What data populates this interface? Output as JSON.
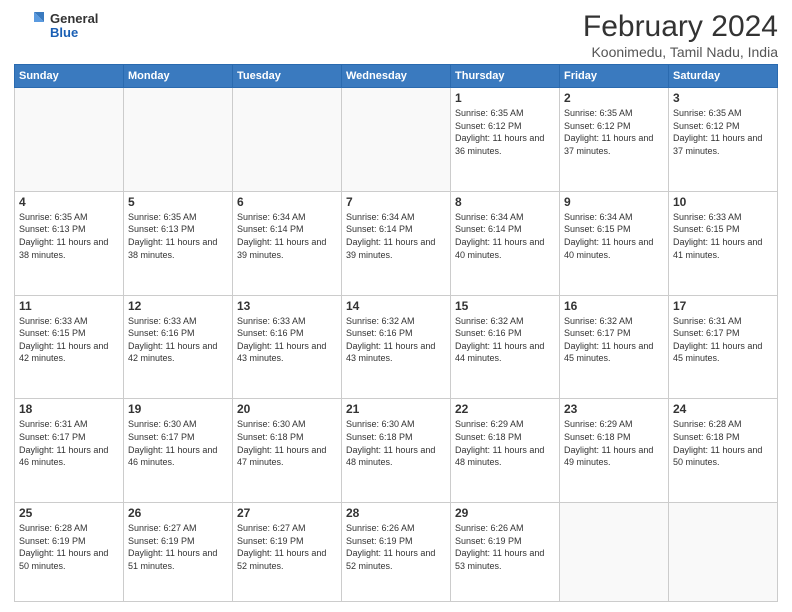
{
  "header": {
    "logo_general": "General",
    "logo_blue": "Blue",
    "title": "February 2024",
    "subtitle": "Koonimedu, Tamil Nadu, India"
  },
  "weekdays": [
    "Sunday",
    "Monday",
    "Tuesday",
    "Wednesday",
    "Thursday",
    "Friday",
    "Saturday"
  ],
  "weeks": [
    [
      {
        "day": "",
        "info": ""
      },
      {
        "day": "",
        "info": ""
      },
      {
        "day": "",
        "info": ""
      },
      {
        "day": "",
        "info": ""
      },
      {
        "day": "1",
        "info": "Sunrise: 6:35 AM\nSunset: 6:12 PM\nDaylight: 11 hours and 36 minutes."
      },
      {
        "day": "2",
        "info": "Sunrise: 6:35 AM\nSunset: 6:12 PM\nDaylight: 11 hours and 37 minutes."
      },
      {
        "day": "3",
        "info": "Sunrise: 6:35 AM\nSunset: 6:12 PM\nDaylight: 11 hours and 37 minutes."
      }
    ],
    [
      {
        "day": "4",
        "info": "Sunrise: 6:35 AM\nSunset: 6:13 PM\nDaylight: 11 hours and 38 minutes."
      },
      {
        "day": "5",
        "info": "Sunrise: 6:35 AM\nSunset: 6:13 PM\nDaylight: 11 hours and 38 minutes."
      },
      {
        "day": "6",
        "info": "Sunrise: 6:34 AM\nSunset: 6:14 PM\nDaylight: 11 hours and 39 minutes."
      },
      {
        "day": "7",
        "info": "Sunrise: 6:34 AM\nSunset: 6:14 PM\nDaylight: 11 hours and 39 minutes."
      },
      {
        "day": "8",
        "info": "Sunrise: 6:34 AM\nSunset: 6:14 PM\nDaylight: 11 hours and 40 minutes."
      },
      {
        "day": "9",
        "info": "Sunrise: 6:34 AM\nSunset: 6:15 PM\nDaylight: 11 hours and 40 minutes."
      },
      {
        "day": "10",
        "info": "Sunrise: 6:33 AM\nSunset: 6:15 PM\nDaylight: 11 hours and 41 minutes."
      }
    ],
    [
      {
        "day": "11",
        "info": "Sunrise: 6:33 AM\nSunset: 6:15 PM\nDaylight: 11 hours and 42 minutes."
      },
      {
        "day": "12",
        "info": "Sunrise: 6:33 AM\nSunset: 6:16 PM\nDaylight: 11 hours and 42 minutes."
      },
      {
        "day": "13",
        "info": "Sunrise: 6:33 AM\nSunset: 6:16 PM\nDaylight: 11 hours and 43 minutes."
      },
      {
        "day": "14",
        "info": "Sunrise: 6:32 AM\nSunset: 6:16 PM\nDaylight: 11 hours and 43 minutes."
      },
      {
        "day": "15",
        "info": "Sunrise: 6:32 AM\nSunset: 6:16 PM\nDaylight: 11 hours and 44 minutes."
      },
      {
        "day": "16",
        "info": "Sunrise: 6:32 AM\nSunset: 6:17 PM\nDaylight: 11 hours and 45 minutes."
      },
      {
        "day": "17",
        "info": "Sunrise: 6:31 AM\nSunset: 6:17 PM\nDaylight: 11 hours and 45 minutes."
      }
    ],
    [
      {
        "day": "18",
        "info": "Sunrise: 6:31 AM\nSunset: 6:17 PM\nDaylight: 11 hours and 46 minutes."
      },
      {
        "day": "19",
        "info": "Sunrise: 6:30 AM\nSunset: 6:17 PM\nDaylight: 11 hours and 46 minutes."
      },
      {
        "day": "20",
        "info": "Sunrise: 6:30 AM\nSunset: 6:18 PM\nDaylight: 11 hours and 47 minutes."
      },
      {
        "day": "21",
        "info": "Sunrise: 6:30 AM\nSunset: 6:18 PM\nDaylight: 11 hours and 48 minutes."
      },
      {
        "day": "22",
        "info": "Sunrise: 6:29 AM\nSunset: 6:18 PM\nDaylight: 11 hours and 48 minutes."
      },
      {
        "day": "23",
        "info": "Sunrise: 6:29 AM\nSunset: 6:18 PM\nDaylight: 11 hours and 49 minutes."
      },
      {
        "day": "24",
        "info": "Sunrise: 6:28 AM\nSunset: 6:18 PM\nDaylight: 11 hours and 50 minutes."
      }
    ],
    [
      {
        "day": "25",
        "info": "Sunrise: 6:28 AM\nSunset: 6:19 PM\nDaylight: 11 hours and 50 minutes."
      },
      {
        "day": "26",
        "info": "Sunrise: 6:27 AM\nSunset: 6:19 PM\nDaylight: 11 hours and 51 minutes."
      },
      {
        "day": "27",
        "info": "Sunrise: 6:27 AM\nSunset: 6:19 PM\nDaylight: 11 hours and 52 minutes."
      },
      {
        "day": "28",
        "info": "Sunrise: 6:26 AM\nSunset: 6:19 PM\nDaylight: 11 hours and 52 minutes."
      },
      {
        "day": "29",
        "info": "Sunrise: 6:26 AM\nSunset: 6:19 PM\nDaylight: 11 hours and 53 minutes."
      },
      {
        "day": "",
        "info": ""
      },
      {
        "day": "",
        "info": ""
      }
    ]
  ]
}
